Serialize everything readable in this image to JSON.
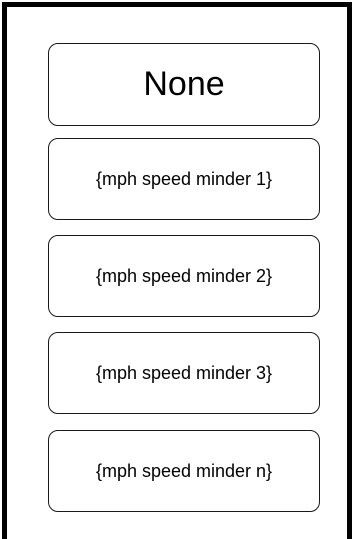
{
  "options": [
    {
      "label": "None"
    },
    {
      "label": "{mph speed minder 1}"
    },
    {
      "label": "{mph speed minder 2}"
    },
    {
      "label": "{mph speed minder 3}"
    },
    {
      "label": "{mph speed minder n}"
    }
  ]
}
